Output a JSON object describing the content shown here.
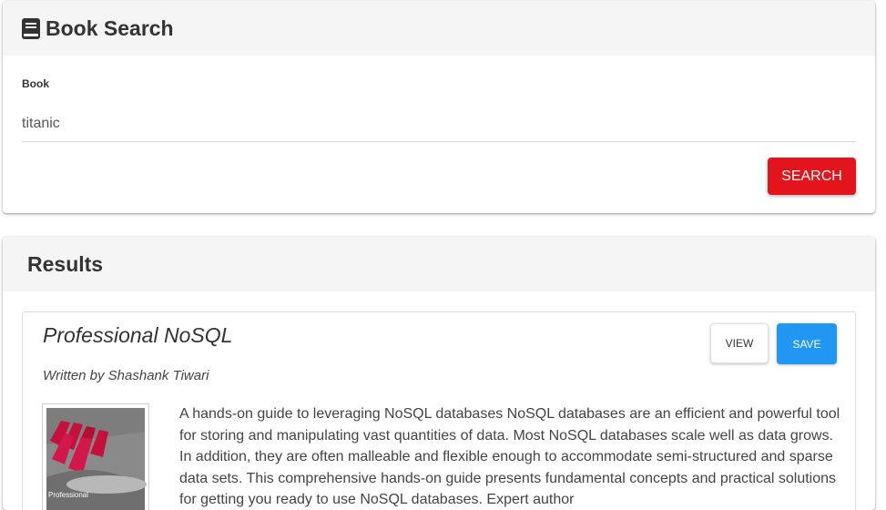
{
  "search": {
    "title": "Book Search",
    "field_label": "Book",
    "query_value": "titanic",
    "button_label": "SEARCH"
  },
  "results": {
    "title": "Results",
    "items": [
      {
        "title": "Professional NoSQL",
        "author": "Written by Shashank Tiwari",
        "view_label": "VIEW",
        "save_label": "SAVE",
        "cover_text": "Professional",
        "description": "A hands-on guide to leveraging NoSQL databases NoSQL databases are an efficient and powerful tool for storing and manipulating vast quantities of data. Most NoSQL databases scale well as data grows. In addition, they are often malleable and flexible enough to accommodate semi-structured and sparse data sets. This comprehensive hands-on guide presents fundamental concepts and practical solutions for getting you ready to use NoSQL databases. Expert author"
      }
    ]
  },
  "colors": {
    "search_button": "#e3141c",
    "save_button": "#2196f3",
    "header_bg": "#f5f5f5"
  },
  "icons": {
    "header": "book-icon"
  }
}
